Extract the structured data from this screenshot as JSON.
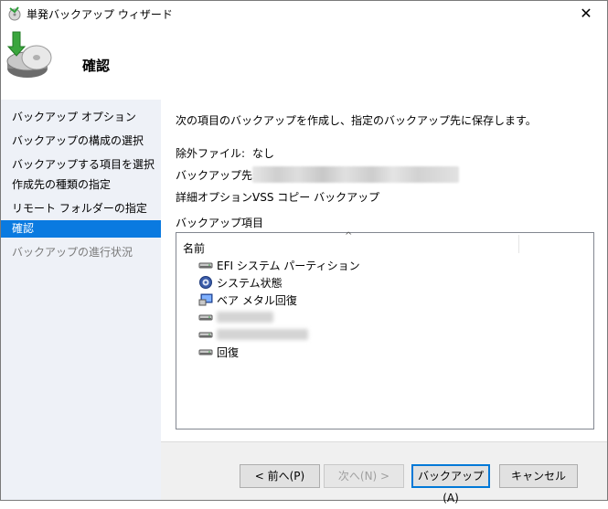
{
  "window": {
    "title": "単発バックアップ ウィザード",
    "close_glyph": "✕"
  },
  "header": {
    "title": "確認",
    "icon": "backup-disk-icon"
  },
  "sidebar": {
    "items": [
      {
        "label": "バックアップ オプション",
        "state": "normal"
      },
      {
        "label": "バックアップの構成の選択",
        "state": "normal"
      },
      {
        "label": "バックアップする項目を選択",
        "state": "normal"
      },
      {
        "label": "作成先の種類の指定",
        "state": "normal"
      },
      {
        "label": "リモート フォルダーの指定",
        "state": "normal"
      },
      {
        "label": "確認",
        "state": "selected"
      },
      {
        "label": "バックアップの進行状況",
        "state": "disabled"
      }
    ]
  },
  "main": {
    "intro": "次の項目のバックアップを作成し、指定のバックアップ先に保存します。",
    "exclude_label": "除外ファイル:",
    "exclude_value": "なし",
    "dest_label": "バックアップ先:",
    "options_label": "詳細オプション:",
    "options_value": "VSS コピー バックアップ",
    "items_label": "バックアップ項目",
    "list": {
      "column_name": "名前",
      "sort_glyph": "^",
      "items": [
        {
          "label": "EFI システム パーティション",
          "icon": "drive-icon"
        },
        {
          "label": "システム状態",
          "icon": "system-state-icon"
        },
        {
          "label": "ベア メタル回復",
          "icon": "bare-metal-icon"
        },
        {
          "label": "",
          "icon": "drive-icon"
        },
        {
          "label": "",
          "icon": "drive-icon"
        },
        {
          "label": "回復",
          "icon": "drive-icon"
        }
      ]
    }
  },
  "buttons": {
    "back": "< 前へ(P)",
    "next": "次へ(N) >",
    "backup": "バックアップ(A)",
    "cancel": "キャンセル"
  },
  "colors": {
    "selected": "#0a7ae0",
    "sidebar_bg": "#eef1f7",
    "footer_bg": "#f0f0f0"
  }
}
